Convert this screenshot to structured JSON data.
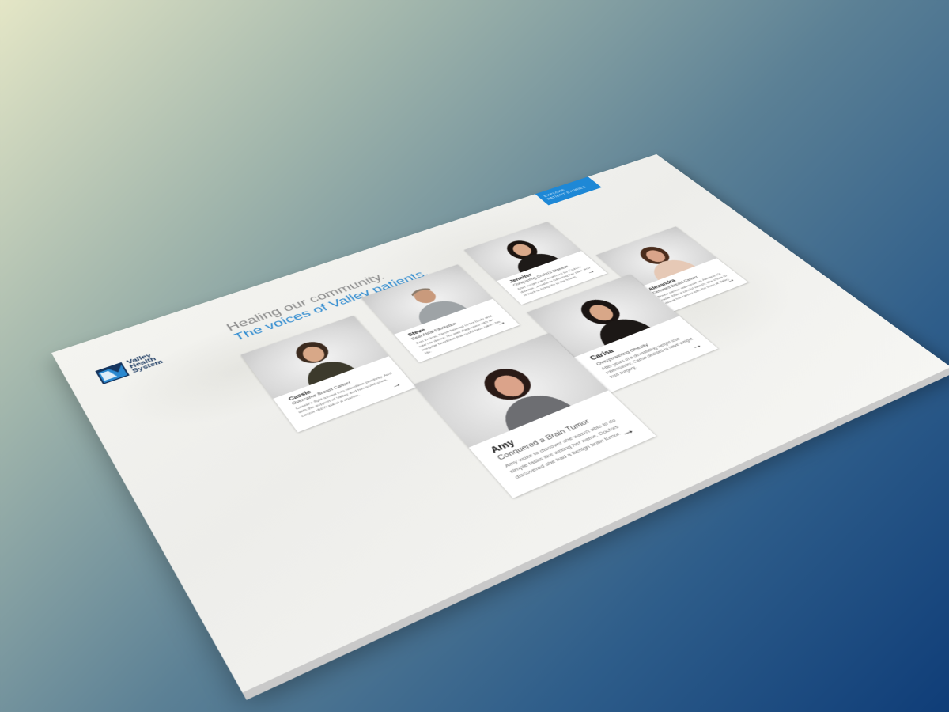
{
  "nav": {
    "button_line1": "EXPLORE",
    "button_line2": "PATIENT STORIES"
  },
  "logo": {
    "line1": "Valley",
    "line2": "Health",
    "line3": "System"
  },
  "headline": {
    "line1": "Healing our community.",
    "line2": "The voices of Valley patients."
  },
  "colors": {
    "accent": "#2a88cf",
    "nav_button": "#1e88d6",
    "logo": "#16355e"
  },
  "patients": [
    {
      "name": "Cassie",
      "subtitle": "Overcame Breast Cancer",
      "description": "Cassie's fight turned into relentless positivity. And with the support of Valley and her loved ones, cancer didn't stand a chance.",
      "arrow": "→"
    },
    {
      "name": "Steve",
      "subtitle": "Beat Atrial Fibrillation",
      "description": "Just in time, Steve listened to his body and saw his doctor. He was diagnosed with an irregular heartbeat that could have taken his life.",
      "arrow": "→"
    },
    {
      "name": "Jennifer",
      "subtitle": "Conquering Crohn's Disease",
      "description": "After surgery and treatment for Crohn's disease, Jennifer is following her plan, and is back to living life to the fullest.",
      "arrow": "→"
    },
    {
      "name": "Alexandra",
      "subtitle": "Defeated Breast Cancer",
      "description": "Breast cancer was never on Alexandra's radar. After a careful search, she chose to defeat her cancer with the team at Valley.",
      "arrow": "→"
    },
    {
      "name": "Carisa",
      "subtitle": "Overpowering Obesity",
      "description": "After years of a devastating weight loss rollercoaster, Carisa decided to have weight loss surgery.",
      "arrow": "→"
    },
    {
      "name": "Amy",
      "subtitle": "Conquered a Brain Tumor",
      "description": "Amy woke to discover she wasn't able to do simple tasks like writing her name. Doctors discovered she had a benign brain tumor.",
      "arrow": "→"
    }
  ]
}
